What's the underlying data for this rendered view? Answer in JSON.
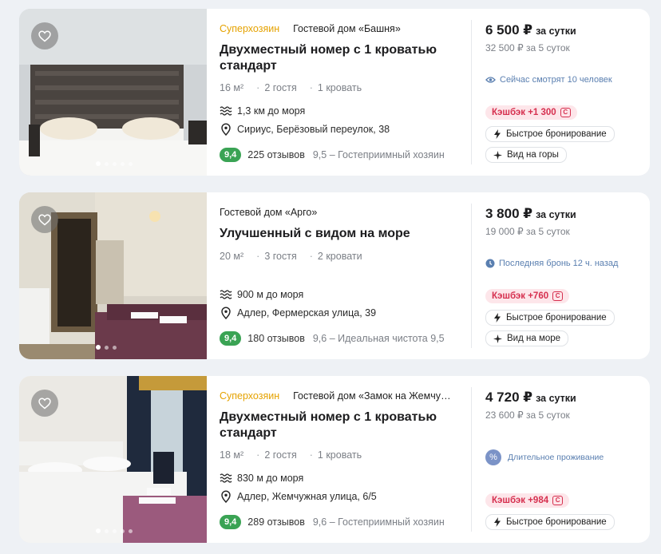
{
  "listings": [
    {
      "superhost": "Суперхозяин",
      "property": "Гостевой дом «Башня»",
      "title": "Двухместный номер с 1 кроватью стандарт",
      "area": "16 м²",
      "guests": "2 гостя",
      "beds": "1 кровать",
      "sea_distance": "1,3 км до моря",
      "address": "Сириус, Берёзовый переулок, 38",
      "score": "9,4",
      "reviews": "225 отзывов",
      "highlight": "9,5 – Гостеприимный хозяин",
      "price": "6 500 ₽",
      "price_unit": "за сутки",
      "total": "32 500 ₽ за 5 суток",
      "notice": "Сейчас смотрят 10 человек",
      "cashback": "Кэшбэк +1 300",
      "chip1": "Быстрое бронирование",
      "chip2": "Вид на горы",
      "photo_dots": 5,
      "active_dot": 0
    },
    {
      "superhost": "",
      "property": "Гостевой дом «Арго»",
      "title": "Улучшенный с видом на море",
      "area": "20 м²",
      "guests": "3 гостя",
      "beds": "2 кровати",
      "sea_distance": "900 м до моря",
      "address": "Адлер, Фермерская улица, 39",
      "score": "9,4",
      "reviews": "180 отзывов",
      "highlight": "9,6 – Идеальная чистота   9,5",
      "price": "3 800 ₽",
      "price_unit": "за сутки",
      "total": "19 000 ₽ за 5 суток",
      "notice": "Последняя бронь 12 ч. назад",
      "cashback": "Кэшбэк +760",
      "chip1": "Быстрое бронирование",
      "chip2": "Вид на море",
      "photo_dots": 3,
      "active_dot": 0
    },
    {
      "superhost": "Суперхозяин",
      "property": "Гостевой дом «Замок на Жемчужной»",
      "title": "Двухместный номер с 1 кроватью стандарт",
      "area": "18 м²",
      "guests": "2 гостя",
      "beds": "1 кровать",
      "sea_distance": "830 м до моря",
      "address": "Адлер, Жемчужная улица, 6/5",
      "score": "9,4",
      "reviews": "289 отзывов",
      "highlight": "9,6 – Гостеприимный хозяин",
      "price": "4 720 ₽",
      "price_unit": "за сутки",
      "total": "23 600 ₽ за 5 суток",
      "long_stay": "Длительное проживание",
      "cashback": "Кэшбэк +984",
      "chip1": "Быстрое бронирование",
      "photo_dots": 5,
      "active_dot": 0
    }
  ],
  "colors": {
    "superhost": "#e5a200",
    "score": "#3aa354",
    "cashback": "#d6304f",
    "notice": "#5a7fb0"
  },
  "icons": [
    "heart-icon",
    "waves-icon",
    "location-pin-icon",
    "eye-icon",
    "clock-icon",
    "percent-icon",
    "cashback-icon",
    "lightning-icon",
    "sparkle-icon"
  ]
}
